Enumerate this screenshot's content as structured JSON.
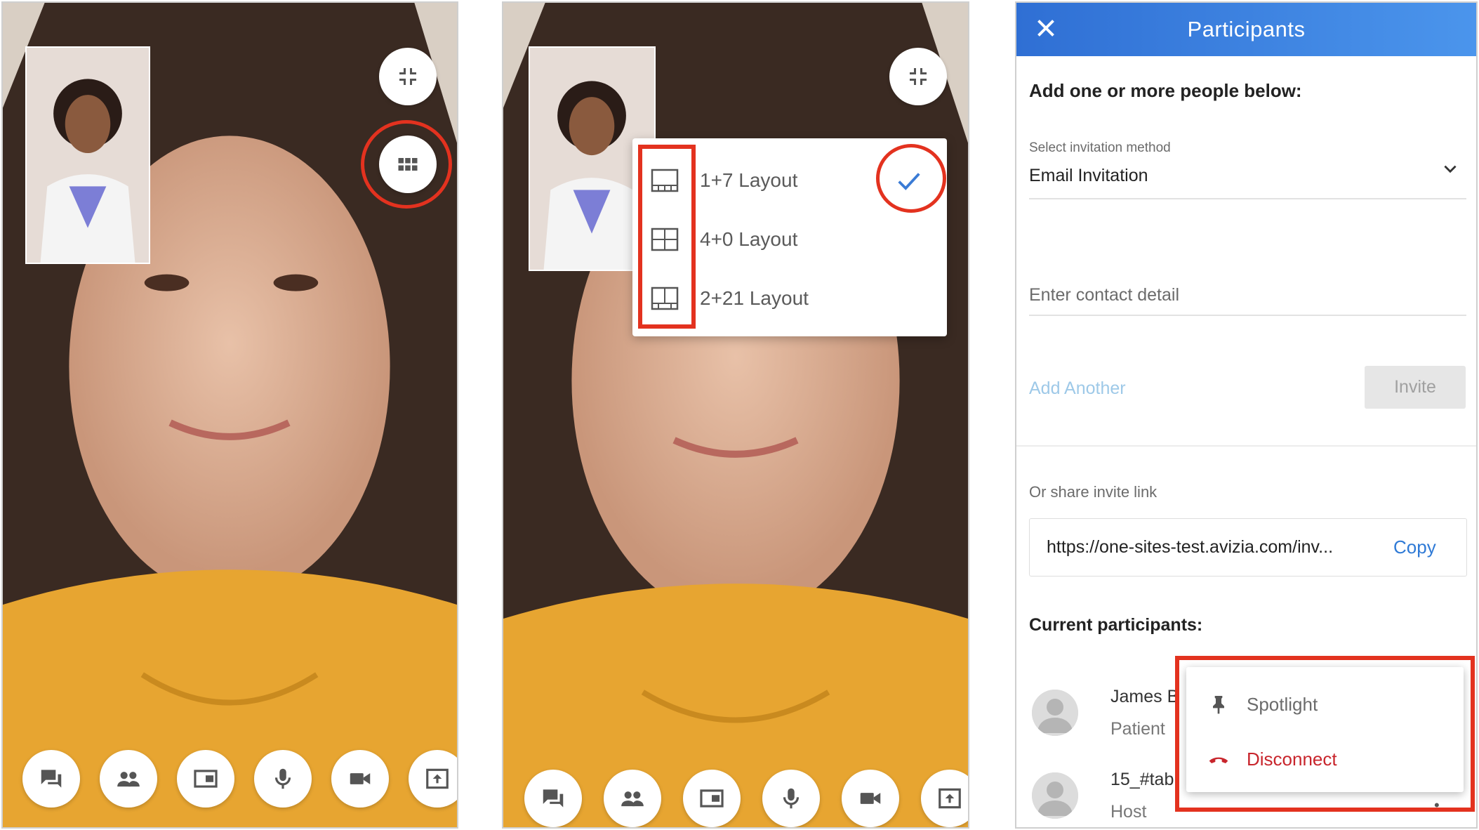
{
  "screen1": {
    "buttons": {
      "minimize": "minimize-icon",
      "layout": "grid-icon"
    },
    "bottom_bar": [
      "chat-icon",
      "participants-icon",
      "pip-icon",
      "microphone-icon",
      "camera-icon",
      "share-icon"
    ]
  },
  "screen2": {
    "layout_menu": {
      "items": [
        {
          "label": "1+7 Layout",
          "icon": "layout-1-7-icon",
          "selected": true
        },
        {
          "label": "4+0 Layout",
          "icon": "layout-4-0-icon",
          "selected": false
        },
        {
          "label": "2+21 Layout",
          "icon": "layout-2-21-icon",
          "selected": false
        }
      ]
    }
  },
  "participants": {
    "title": "Participants",
    "add_heading": "Add one or more people below:",
    "invitation_method_label": "Select invitation method",
    "invitation_method_value": "Email Invitation",
    "contact_placeholder": "Enter contact detail",
    "add_another": "Add Another",
    "invite_button": "Invite",
    "share_label": "Or share invite link",
    "invite_link": "https://one-sites-test.avizia.com/inv...",
    "copy_button": "Copy",
    "current_heading": "Current participants:",
    "list": [
      {
        "name": "James B",
        "role": "Patient"
      },
      {
        "name": "15_#tab",
        "role": "Host"
      }
    ],
    "actions": [
      {
        "label": "Spotlight",
        "icon": "pin-icon",
        "color": "#6b6b6b"
      },
      {
        "label": "Disconnect",
        "icon": "hang-up-icon",
        "color": "#c8252c"
      }
    ]
  },
  "colors": {
    "highlight": "#e3321f",
    "header_start": "#2f6fd4",
    "header_end": "#4b95ec",
    "link": "#2f7ad6"
  }
}
